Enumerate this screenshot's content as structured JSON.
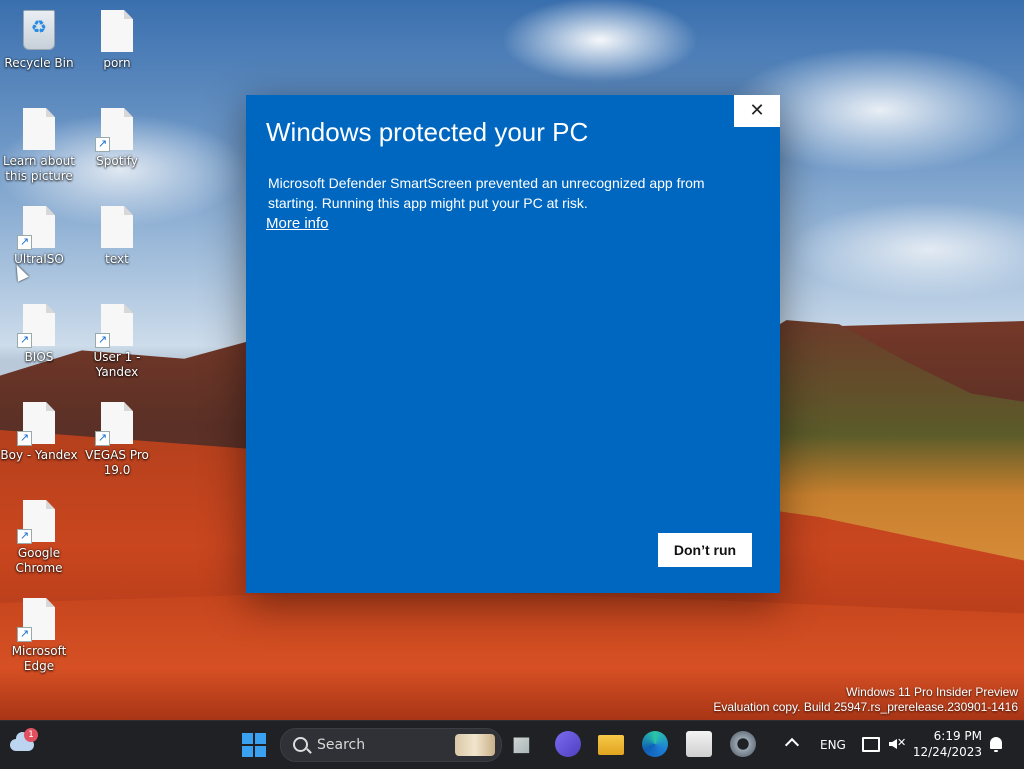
{
  "desktop": {
    "icons": [
      {
        "label": "Recycle Bin",
        "kind": "recycle-bin-icon"
      },
      {
        "label": "porn",
        "kind": "file-icon"
      },
      {
        "label": "Learn about this picture",
        "kind": "file-icon"
      },
      {
        "label": "Spotify",
        "kind": "shortcut-icon"
      },
      {
        "label": "UltraISO",
        "kind": "shortcut-icon"
      },
      {
        "label": "text",
        "kind": "file-icon"
      },
      {
        "label": "BIOS",
        "kind": "shortcut-icon"
      },
      {
        "label": "User 1 - Yandex",
        "kind": "shortcut-icon"
      },
      {
        "label": "Boy - Yandex",
        "kind": "shortcut-icon"
      },
      {
        "label": "VEGAS Pro 19.0",
        "kind": "shortcut-icon"
      },
      {
        "label": "Google Chrome",
        "kind": "shortcut-icon"
      },
      {
        "label": "Microsoft Edge",
        "kind": "shortcut-icon"
      }
    ],
    "watermark": {
      "line1": "Windows 11 Pro Insider Preview",
      "line2": "Evaluation copy. Build 25947.rs_prerelease.230901-1416"
    }
  },
  "dialog": {
    "title": "Windows protected your PC",
    "body": "Microsoft Defender SmartScreen prevented an unrecognized app from starting. Running this app might put your PC at risk.",
    "more_info": "More info",
    "dont_run": "Don’t run",
    "close_glyph": "✕",
    "bg_color": "#0067c0"
  },
  "taskbar": {
    "weather_badge": "1",
    "search_placeholder": "Search",
    "language": "ENG",
    "time": "6:19 PM",
    "date": "12/24/2023",
    "mute_glyph": "✕"
  }
}
